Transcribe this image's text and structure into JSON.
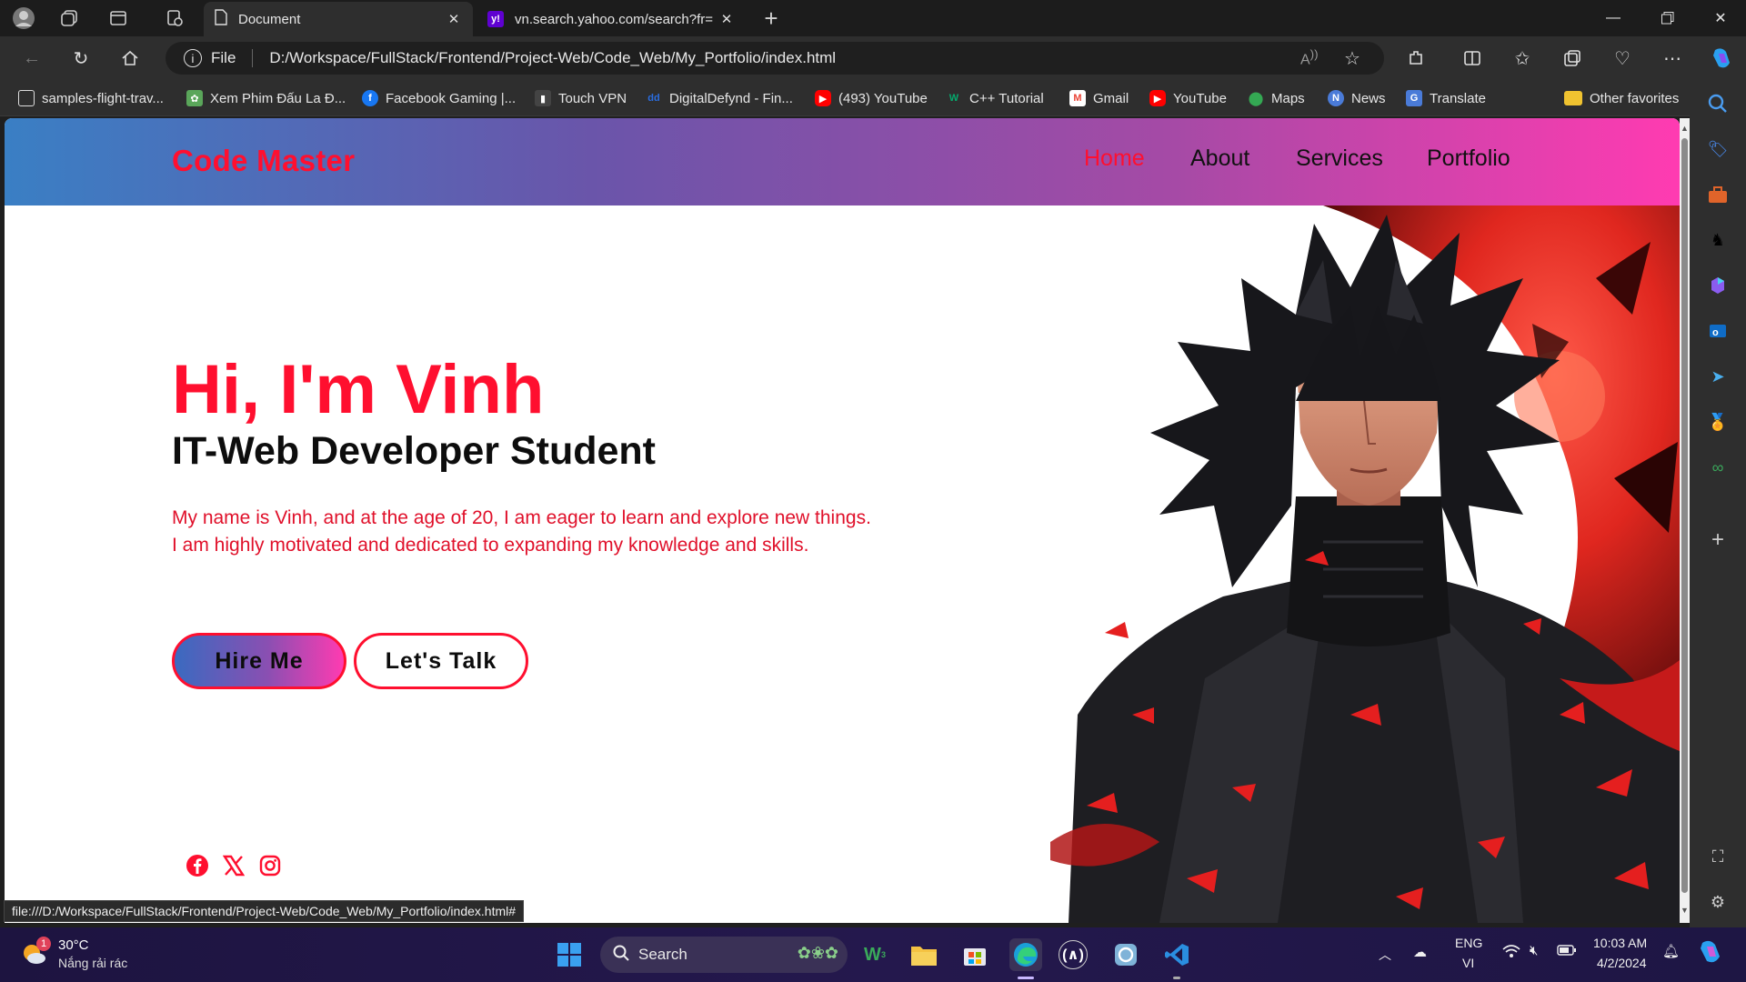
{
  "browser": {
    "tabs": [
      {
        "title": "Document",
        "active": true
      },
      {
        "title": "vn.search.yahoo.com/search?fr=",
        "active": false
      }
    ],
    "address": {
      "scheme_label": "File",
      "url": "D:/Workspace/FullStack/Frontend/Project-Web/Code_Web/My_Portfolio/index.html"
    },
    "favorites": [
      {
        "label": "samples-flight-trav...",
        "icon": "page-icon",
        "color": "#e6e6e6"
      },
      {
        "label": "Xem Phim Đấu La Đ...",
        "icon": "film-icon",
        "color": "#5aa65a"
      },
      {
        "label": "Facebook Gaming |...",
        "icon": "facebook-icon",
        "color": "#1877f2"
      },
      {
        "label": "Touch VPN",
        "icon": "vpn-icon",
        "color": "#444"
      },
      {
        "label": "DigitalDefynd - Fin...",
        "icon": "dd-icon",
        "color": "#2a6de0"
      },
      {
        "label": "(493) YouTube",
        "icon": "youtube-icon",
        "color": "#ff0000"
      },
      {
        "label": "C++ Tutorial",
        "icon": "w3-icon",
        "color": "#04aa6d"
      },
      {
        "label": "Gmail",
        "icon": "gmail-icon",
        "color": "#ea4335"
      },
      {
        "label": "YouTube",
        "icon": "youtube-icon",
        "color": "#ff0000"
      },
      {
        "label": "Maps",
        "icon": "maps-icon",
        "color": "#34a853"
      },
      {
        "label": "News",
        "icon": "news-icon",
        "color": "#4a7bd8"
      },
      {
        "label": "Translate",
        "icon": "translate-icon",
        "color": "#4a7bd8"
      }
    ],
    "other_favorites": "Other favorites",
    "status_url": "file:///D:/Workspace/FullStack/Frontend/Project-Web/Code_Web/My_Portfolio/index.html#"
  },
  "site": {
    "logo": "Code Master",
    "nav": [
      {
        "label": "Home",
        "active": true
      },
      {
        "label": "About",
        "active": false
      },
      {
        "label": "Services",
        "active": false
      },
      {
        "label": "Portfolio",
        "active": false
      }
    ],
    "hero": {
      "title": "Hi, I'm Vinh",
      "subtitle": "IT-Web Developer Student",
      "description": "My name is Vinh, and at the age of 20, I am eager to learn and explore new things. I am highly motivated and dedicated to expanding my knowledge and skills.",
      "primary_button": "Hire Me",
      "secondary_button": "Let's Talk"
    },
    "socials": [
      "facebook-icon",
      "x-icon",
      "instagram-icon"
    ],
    "colors": {
      "accent": "#ff0f2f",
      "gradient_start": "#3a7fc4",
      "gradient_end": "#ff3bb1"
    }
  },
  "taskbar": {
    "weather": {
      "temp": "30°C",
      "desc": "Nắng rải rác",
      "badge": "1"
    },
    "search_label": "Search",
    "lang_top": "ENG",
    "lang_bottom": "VI",
    "time": "10:03 AM",
    "date": "4/2/2024"
  }
}
